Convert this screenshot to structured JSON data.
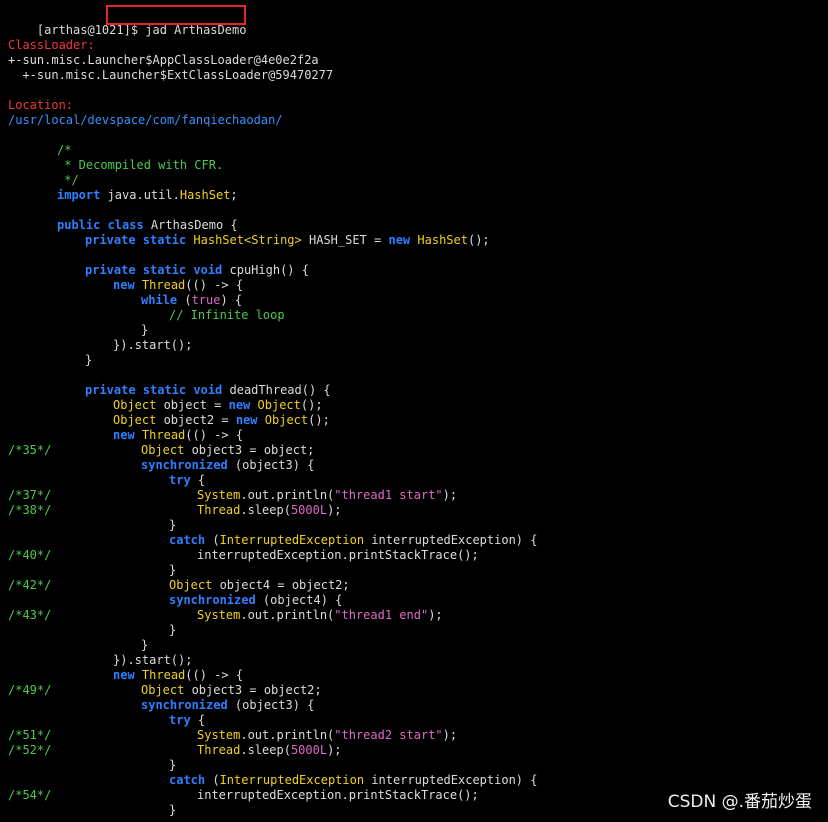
{
  "terminal": {
    "prompt": "[arthas@1021]$ ",
    "command": "jad ArthasDemo",
    "classloader_label": "ClassLoader:",
    "classloader_1": "+-sun.misc.Launcher$AppClassLoader@4e0e2f2a",
    "classloader_2": "  +-sun.misc.Launcher$ExtClassLoader@59470277",
    "location_label": "Location:",
    "location_path": "/usr/local/devspace/com/fanqiechaodan/"
  },
  "code_lines": [
    {
      "n": "",
      "indent": 7,
      "parts": [
        [
          "cm",
          "/*"
        ]
      ]
    },
    {
      "n": "",
      "indent": 7,
      "parts": [
        [
          "cm",
          " * Decompiled with CFR."
        ]
      ]
    },
    {
      "n": "",
      "indent": 7,
      "parts": [
        [
          "cm",
          " */"
        ]
      ]
    },
    {
      "n": "",
      "indent": 7,
      "parts": [
        [
          "kw",
          "import"
        ],
        [
          "",
          " java.util."
        ],
        [
          "ty",
          "HashSet"
        ],
        [
          "",
          ";"
        ]
      ]
    },
    {
      "n": "",
      "indent": 0,
      "parts": []
    },
    {
      "n": "",
      "indent": 7,
      "parts": [
        [
          "kw",
          "public class"
        ],
        [
          "",
          " ArthasDemo {"
        ]
      ]
    },
    {
      "n": "",
      "indent": 11,
      "parts": [
        [
          "kw",
          "private static"
        ],
        [
          "",
          " "
        ],
        [
          "ty",
          "HashSet<String>"
        ],
        [
          "",
          " HASH_SET = "
        ],
        [
          "kw",
          "new"
        ],
        [
          "",
          " "
        ],
        [
          "ty",
          "HashSet"
        ],
        [
          "",
          "();"
        ]
      ]
    },
    {
      "n": "",
      "indent": 0,
      "parts": []
    },
    {
      "n": "",
      "indent": 11,
      "parts": [
        [
          "kw",
          "private static void"
        ],
        [
          "",
          " cpuHigh() {"
        ]
      ]
    },
    {
      "n": "",
      "indent": 15,
      "parts": [
        [
          "kw",
          "new"
        ],
        [
          "",
          " "
        ],
        [
          "ty",
          "Thread"
        ],
        [
          "",
          "(() -> {"
        ]
      ]
    },
    {
      "n": "",
      "indent": 19,
      "parts": [
        [
          "kw",
          "while"
        ],
        [
          "",
          " ("
        ],
        [
          "str",
          "true"
        ],
        [
          "",
          ") {"
        ]
      ]
    },
    {
      "n": "",
      "indent": 23,
      "parts": [
        [
          "cm",
          "// Infinite loop"
        ]
      ]
    },
    {
      "n": "",
      "indent": 19,
      "parts": [
        [
          "",
          "}"
        ]
      ]
    },
    {
      "n": "",
      "indent": 15,
      "parts": [
        [
          "",
          "}).start();"
        ]
      ]
    },
    {
      "n": "",
      "indent": 11,
      "parts": [
        [
          "",
          "}"
        ]
      ]
    },
    {
      "n": "",
      "indent": 0,
      "parts": []
    },
    {
      "n": "",
      "indent": 11,
      "parts": [
        [
          "kw",
          "private static void"
        ],
        [
          "",
          " deadThread() {"
        ]
      ]
    },
    {
      "n": "",
      "indent": 15,
      "parts": [
        [
          "ty",
          "Object"
        ],
        [
          "",
          " object = "
        ],
        [
          "kw",
          "new"
        ],
        [
          "",
          " "
        ],
        [
          "ty",
          "Object"
        ],
        [
          "",
          "();"
        ]
      ]
    },
    {
      "n": "",
      "indent": 15,
      "parts": [
        [
          "ty",
          "Object"
        ],
        [
          "",
          " object2 = "
        ],
        [
          "kw",
          "new"
        ],
        [
          "",
          " "
        ],
        [
          "ty",
          "Object"
        ],
        [
          "",
          "();"
        ]
      ]
    },
    {
      "n": "",
      "indent": 15,
      "parts": [
        [
          "kw",
          "new"
        ],
        [
          "",
          " "
        ],
        [
          "ty",
          "Thread"
        ],
        [
          "",
          "(() -> {"
        ]
      ]
    },
    {
      "n": "/*35*/",
      "indent": 19,
      "parts": [
        [
          "ty",
          "Object"
        ],
        [
          "",
          " object3 = object;"
        ]
      ]
    },
    {
      "n": "",
      "indent": 19,
      "parts": [
        [
          "kw",
          "synchronized"
        ],
        [
          "",
          " (object3) {"
        ]
      ]
    },
    {
      "n": "",
      "indent": 23,
      "parts": [
        [
          "kw",
          "try"
        ],
        [
          "",
          " {"
        ]
      ]
    },
    {
      "n": "/*37*/",
      "indent": 27,
      "parts": [
        [
          "ty",
          "System"
        ],
        [
          "",
          ".out.println("
        ],
        [
          "str",
          "\"thread1 start\""
        ],
        [
          "",
          ");"
        ]
      ]
    },
    {
      "n": "/*38*/",
      "indent": 27,
      "parts": [
        [
          "ty",
          "Thread"
        ],
        [
          "",
          ".sleep("
        ],
        [
          "num",
          "5000L"
        ],
        [
          "",
          ");"
        ]
      ]
    },
    {
      "n": "",
      "indent": 23,
      "parts": [
        [
          "",
          "}"
        ]
      ]
    },
    {
      "n": "",
      "indent": 23,
      "parts": [
        [
          "kw",
          "catch"
        ],
        [
          "",
          " ("
        ],
        [
          "ty",
          "InterruptedException"
        ],
        [
          "",
          " interruptedException) {"
        ]
      ]
    },
    {
      "n": "/*40*/",
      "indent": 27,
      "parts": [
        [
          "",
          "interruptedException.printStackTrace();"
        ]
      ]
    },
    {
      "n": "",
      "indent": 23,
      "parts": [
        [
          "",
          "}"
        ]
      ]
    },
    {
      "n": "/*42*/",
      "indent": 23,
      "parts": [
        [
          "ty",
          "Object"
        ],
        [
          "",
          " object4 = object2;"
        ]
      ]
    },
    {
      "n": "",
      "indent": 23,
      "parts": [
        [
          "kw",
          "synchronized"
        ],
        [
          "",
          " (object4) {"
        ]
      ]
    },
    {
      "n": "/*43*/",
      "indent": 27,
      "parts": [
        [
          "ty",
          "System"
        ],
        [
          "",
          ".out.println("
        ],
        [
          "str",
          "\"thread1 end\""
        ],
        [
          "",
          ");"
        ]
      ]
    },
    {
      "n": "",
      "indent": 23,
      "parts": [
        [
          "",
          "}"
        ]
      ]
    },
    {
      "n": "",
      "indent": 19,
      "parts": [
        [
          "",
          "}"
        ]
      ]
    },
    {
      "n": "",
      "indent": 15,
      "parts": [
        [
          "",
          "}).start();"
        ]
      ]
    },
    {
      "n": "",
      "indent": 15,
      "parts": [
        [
          "kw",
          "new"
        ],
        [
          "",
          " "
        ],
        [
          "ty",
          "Thread"
        ],
        [
          "",
          "(() -> {"
        ]
      ]
    },
    {
      "n": "/*49*/",
      "indent": 19,
      "parts": [
        [
          "ty",
          "Object"
        ],
        [
          "",
          " object3 = object2;"
        ]
      ]
    },
    {
      "n": "",
      "indent": 19,
      "parts": [
        [
          "kw",
          "synchronized"
        ],
        [
          "",
          " (object3) {"
        ]
      ]
    },
    {
      "n": "",
      "indent": 23,
      "parts": [
        [
          "kw",
          "try"
        ],
        [
          "",
          " {"
        ]
      ]
    },
    {
      "n": "/*51*/",
      "indent": 27,
      "parts": [
        [
          "ty",
          "System"
        ],
        [
          "",
          ".out.println("
        ],
        [
          "str",
          "\"thread2 start\""
        ],
        [
          "",
          ");"
        ]
      ]
    },
    {
      "n": "/*52*/",
      "indent": 27,
      "parts": [
        [
          "ty",
          "Thread"
        ],
        [
          "",
          ".sleep("
        ],
        [
          "num",
          "5000L"
        ],
        [
          "",
          ");"
        ]
      ]
    },
    {
      "n": "",
      "indent": 23,
      "parts": [
        [
          "",
          "}"
        ]
      ]
    },
    {
      "n": "",
      "indent": 23,
      "parts": [
        [
          "kw",
          "catch"
        ],
        [
          "",
          " ("
        ],
        [
          "ty",
          "InterruptedException"
        ],
        [
          "",
          " interruptedException) {"
        ]
      ]
    },
    {
      "n": "/*54*/",
      "indent": 27,
      "parts": [
        [
          "",
          "interruptedException.printStackTrace();"
        ]
      ]
    },
    {
      "n": "",
      "indent": 23,
      "parts": [
        [
          "",
          "}"
        ]
      ]
    }
  ],
  "watermark": "CSDN @.番茄炒蛋",
  "colors": {
    "background": "#000000",
    "text": "#dcdcdc",
    "keyword": "#2f7fff",
    "type": "#f0d020",
    "string": "#d96cc4",
    "comment": "#4ec94e",
    "label_red": "#ee3a3a",
    "highlight_box": "#e8212c"
  }
}
